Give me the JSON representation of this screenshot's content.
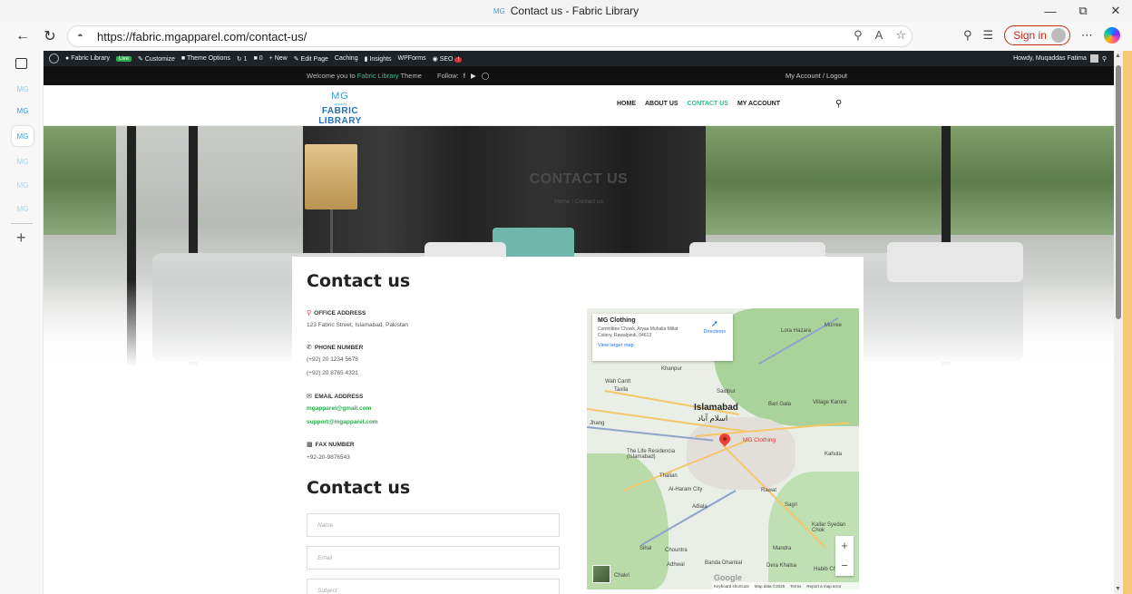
{
  "browser": {
    "window_title": "Contact us - Fabric Library",
    "url": "https://fabric.mgapparel.com/contact-us/",
    "sign_in_label": "Sign in",
    "tab_icon": "mg-favicon-icon"
  },
  "sidebar": {
    "items": [
      "MG",
      "MG",
      "MG",
      "MG",
      "MG",
      "MG"
    ]
  },
  "admin_bar": {
    "site_name": "Fabric Library",
    "live_badge": "Live",
    "customize": "Customize",
    "theme_options": "Theme Options",
    "updates_count": "1",
    "comments_count": "0",
    "new": "New",
    "edit_page": "Edit Page",
    "caching": "Caching",
    "insights": "Insights",
    "wpforms": "WPForms",
    "seo": "SEO",
    "seo_badge": "!",
    "howdy": "Howdy, Muqaddas Fatima"
  },
  "topbar": {
    "welcome_prefix": "Welcome you to",
    "brand": "Fabric Library",
    "welcome_suffix": "Theme",
    "follow": "Follow:",
    "account": "My Account / Logout"
  },
  "header": {
    "logo_mg": "MG",
    "logo_apparel": "apparel",
    "logo_name": "FABRIC LIBRARY",
    "menu": [
      "HOME",
      "ABOUT US",
      "CONTACT US",
      "MY ACCOUNT"
    ]
  },
  "hero": {
    "title": "CONTACT US",
    "breadcrumb": "Home  /  Contact us"
  },
  "contact": {
    "heading": "Contact us",
    "office_label": "OFFICE ADDRESS",
    "office_value": "123 Fabric Street, Islamabad, Pakistan",
    "phone_label": "PHONE NUMBER",
    "phone_1": "(+92) 20 1234 5678",
    "phone_2": "(+92) 20 8765 4321",
    "email_label": "EMAIL ADDRESS",
    "email_1": "mgapparel@gmail.com",
    "email_2": "support@mgapparel.com",
    "fax_label": "FAX NUMBER",
    "fax_value": "+92-20-9876543",
    "form_heading": "Contact us",
    "form": {
      "name_placeholder": "Name",
      "email_placeholder": "Email",
      "subject_placeholder": "Subject"
    }
  },
  "map": {
    "place_title": "MG Clothing",
    "place_address": "Committee Chowk, Aryaa Mohalla Millat Colony, Rawalpindi, 04613",
    "directions": "Directions",
    "larger_map": "View larger map",
    "labels": {
      "islamabad": "Islamabad",
      "islamabad_urdu": "اسلام آباد",
      "mg_clothing": "MG Clothing",
      "murree": "Murree",
      "lora_hazara": "Lora Hazara",
      "khanpur": "Khanpur",
      "wah_cantt": "Wah Cantt",
      "taxila": "Taxila",
      "saidpur": "Saidpur",
      "bari_gala": "Bari Gala",
      "village_karore": "Village Karore",
      "jhang": "Jhang",
      "the_life_residencia": "The Life Residencia (Islamabad)",
      "thalian": "Thalian",
      "al_haram_city": "Al-Haram City",
      "kahuta": "Kahuta",
      "rawat": "Rawat",
      "adiala": "Adiala",
      "sagri": "Sagri",
      "kallar_syedan": "Kallar Syedan Chok",
      "mandra": "Mandra",
      "chountra": "Chountra",
      "sihal": "Sihal",
      "adhwal": "Adhwal",
      "banda_dhamial": "Banda Dhamial",
      "dera_khalsa": "Dera Khalsa",
      "habib_chowk": "Habib Ch",
      "chakri": "Chakri"
    },
    "footer": [
      "Keyboard shortcuts",
      "Map data ©2025",
      "Terms",
      "Report a map error"
    ],
    "google": "Google"
  }
}
